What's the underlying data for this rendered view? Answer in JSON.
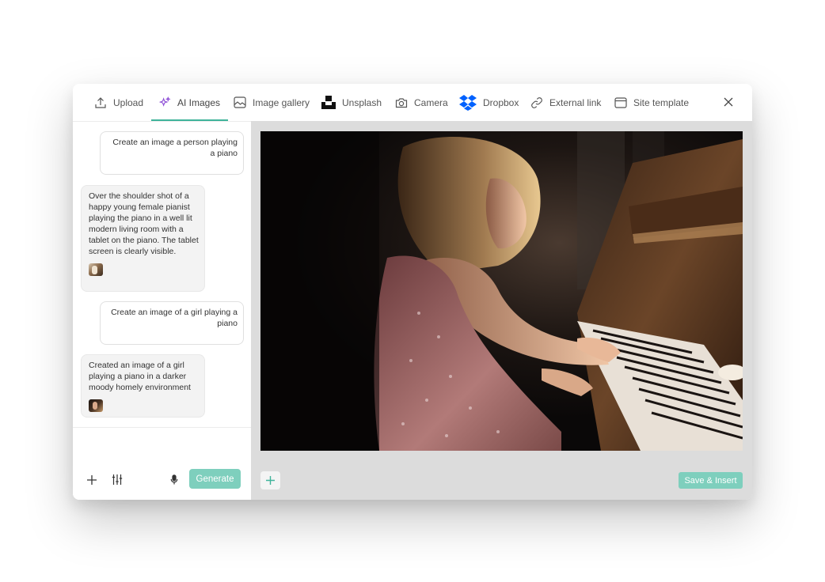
{
  "tabs": [
    {
      "label": "Upload",
      "icon": "upload-icon"
    },
    {
      "label": "AI Images",
      "icon": "sparkle-icon"
    },
    {
      "label": "Image gallery",
      "icon": "image-gallery-icon"
    },
    {
      "label": "Unsplash",
      "icon": "unsplash-icon"
    },
    {
      "label": "Camera",
      "icon": "camera-icon"
    },
    {
      "label": "Dropbox",
      "icon": "dropbox-icon"
    },
    {
      "label": "External link",
      "icon": "link-icon"
    },
    {
      "label": "Site template",
      "icon": "browser-window-icon"
    }
  ],
  "active_tab": "AI Images",
  "chat": {
    "messages": [
      {
        "role": "user",
        "text": "Create an image a person playing a piano"
      },
      {
        "role": "ai",
        "text": "Over the shoulder shot of a happy young female pianist playing the piano in a well lit modern living room with a tablet on the piano. The tablet screen is clearly visible."
      },
      {
        "role": "user",
        "text": "Create an image of a girl playing a piano"
      },
      {
        "role": "ai",
        "text": "Created an image of a girl playing a piano in a darker moody homely environment"
      }
    ],
    "generate_label": "Generate"
  },
  "preview": {
    "save_label": "Save & Insert"
  },
  "colors": {
    "accent": "#3fb39a",
    "button": "#7ecfbd",
    "ai_purple": "#8e4fd6",
    "dropbox_blue": "#0061fe"
  }
}
